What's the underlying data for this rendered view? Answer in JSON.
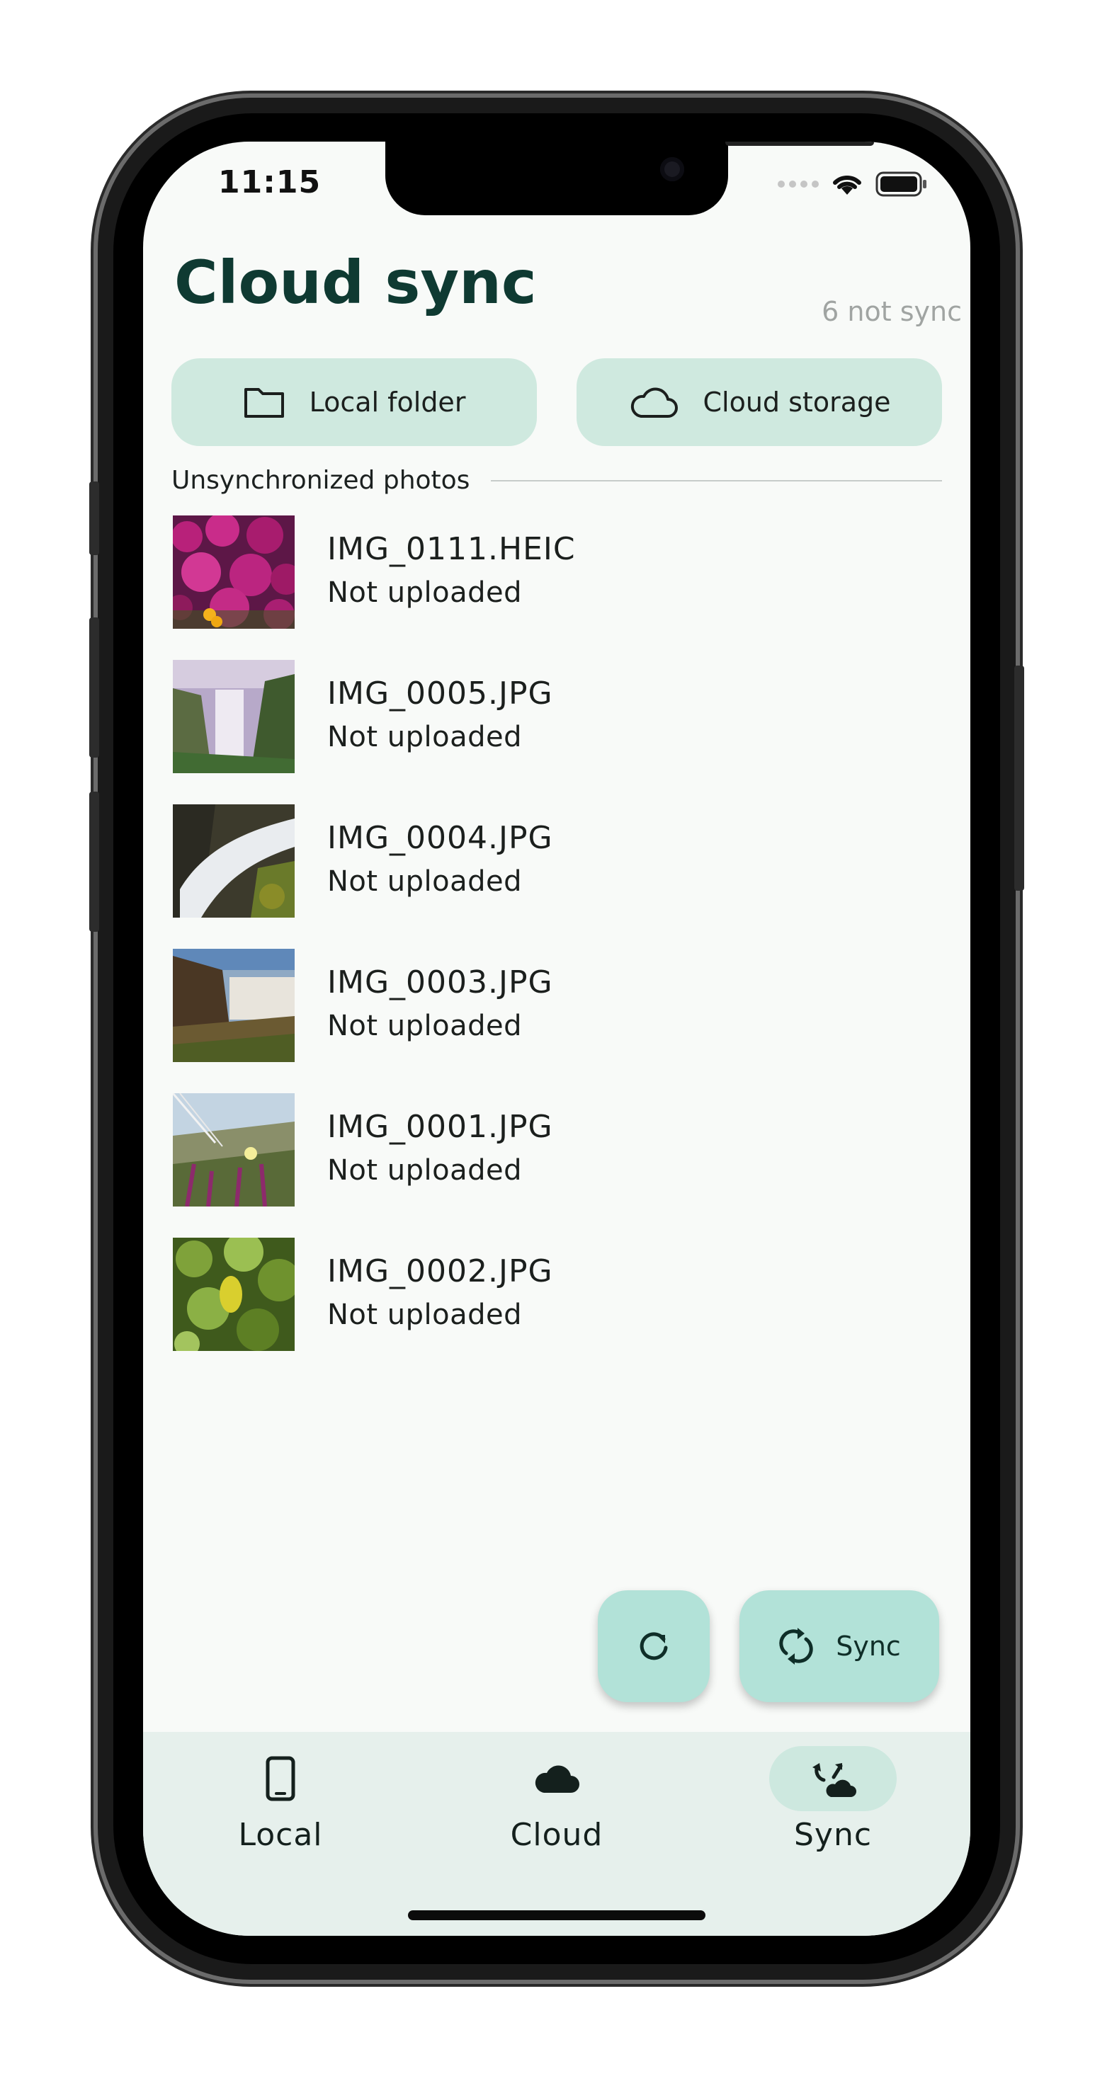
{
  "status_bar": {
    "time": "11:15"
  },
  "header": {
    "title": "Cloud sync",
    "not_synced": "6 not sync"
  },
  "source_buttons": {
    "local_label": "Local folder",
    "cloud_label": "Cloud storage"
  },
  "section": {
    "label": "Unsynchronized photos"
  },
  "photos": [
    {
      "name": "IMG_0111.HEIC",
      "status": "Not uploaded"
    },
    {
      "name": "IMG_0005.JPG",
      "status": "Not uploaded"
    },
    {
      "name": "IMG_0004.JPG",
      "status": "Not uploaded"
    },
    {
      "name": "IMG_0003.JPG",
      "status": "Not uploaded"
    },
    {
      "name": "IMG_0001.JPG",
      "status": "Not uploaded"
    },
    {
      "name": "IMG_0002.JPG",
      "status": "Not uploaded"
    }
  ],
  "actions": {
    "sync_label": "Sync"
  },
  "nav": {
    "items": [
      {
        "label": "Local",
        "icon": "phone-icon"
      },
      {
        "label": "Cloud",
        "icon": "cloud-filled-icon"
      },
      {
        "label": "Sync",
        "icon": "cloud-sync-icon",
        "active": true
      }
    ]
  },
  "colors": {
    "title": "#0f3a32",
    "chip_bg": "#cfe9df",
    "fab_bg": "#b2e2d8",
    "nav_bg": "#e6f0ec"
  }
}
